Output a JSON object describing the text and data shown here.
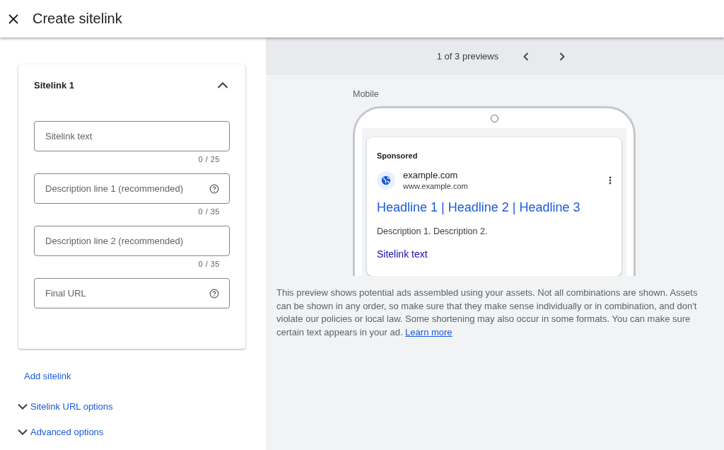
{
  "header": {
    "title": "Create sitelink"
  },
  "sitelink": {
    "title": "Sitelink 1",
    "expanded": true,
    "fields": [
      {
        "placeholder": "Sitelink text",
        "counter": "0 / 25",
        "help": false
      },
      {
        "placeholder": "Description line 1 (recommended)",
        "counter": "0 / 35",
        "help": true
      },
      {
        "placeholder": "Description line 2 (recommended)",
        "counter": "0 / 35",
        "help": false
      },
      {
        "placeholder": "Final URL",
        "help": true
      }
    ]
  },
  "add_sitelink": "Add sitelink",
  "options": [
    {
      "label": "Sitelink URL options",
      "expanded": false
    },
    {
      "label": "Advanced options",
      "expanded": false
    }
  ],
  "preview": {
    "pager": "1 of 3 previews",
    "device": "Mobile",
    "ad": {
      "label": "Sponsored",
      "site": "example.com",
      "url": "www.example.com",
      "headline": "Headline 1 | Headline 2 | Headline 3",
      "description": "Description 1. Description 2.",
      "sitelink": "Sitelink text"
    },
    "note": "This preview shows potential ads assembled using your assets. Not all combinations are shown. Assets can be shown in any order, so make sure that they make sense individually or in combination, and don't violate our policies or local law. Some shortening may also occur in some formats. You can make sure certain text appears in your ad.",
    "note_link": "Learn more"
  }
}
